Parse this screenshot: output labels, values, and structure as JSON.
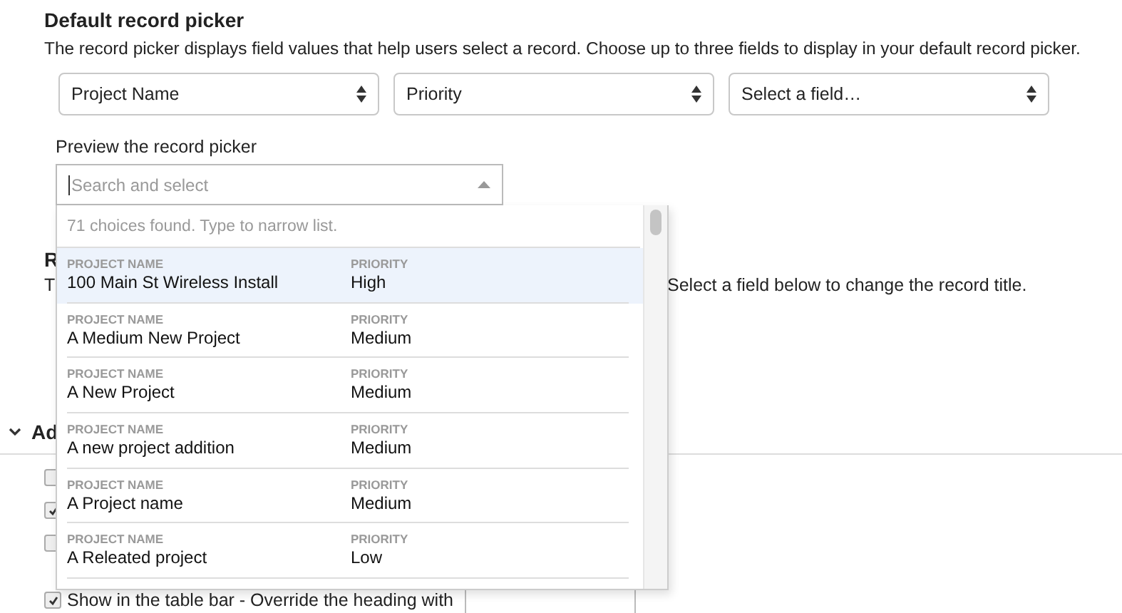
{
  "title": "Default record picker",
  "description": "The record picker displays field values that help users select a record. Choose up to three fields to display in your default record picker.",
  "field_selects": [
    {
      "value": "Project Name"
    },
    {
      "value": "Priority"
    },
    {
      "value": "Select a field…"
    }
  ],
  "preview": {
    "label": "Preview the record picker",
    "placeholder": "Search and select",
    "expanded": true,
    "status": "71 choices found. Type to narrow list.",
    "options": [
      {
        "name_label": "PROJECT NAME",
        "name": "100 Main St Wireless Install",
        "priority_label": "PRIORITY",
        "priority": "High",
        "selected": true
      },
      {
        "name_label": "PROJECT NAME",
        "name": "A Medium New Project",
        "priority_label": "PRIORITY",
        "priority": "Medium",
        "selected": false
      },
      {
        "name_label": "PROJECT NAME",
        "name": "A New Project",
        "priority_label": "PRIORITY",
        "priority": "Medium",
        "selected": false
      },
      {
        "name_label": "PROJECT NAME",
        "name": "A new project addition",
        "priority_label": "PRIORITY",
        "priority": "Medium",
        "selected": false
      },
      {
        "name_label": "PROJECT NAME",
        "name": "A Project name",
        "priority_label": "PRIORITY",
        "priority": "Medium",
        "selected": false
      },
      {
        "name_label": "PROJECT NAME",
        "name": "A Releated project",
        "priority_label": "PRIORITY",
        "priority": "Low",
        "selected": false
      }
    ]
  },
  "record_title": {
    "heading": "R",
    "description_start": "T",
    "description_end": "Select a field below to change the record title."
  },
  "advanced": {
    "heading": "Ad",
    "expanded": true,
    "options": [
      {
        "checked": false
      },
      {
        "checked": true
      },
      {
        "checked": false
      },
      {
        "checked": true,
        "label": "Show in the table bar - Override the heading with"
      }
    ]
  }
}
